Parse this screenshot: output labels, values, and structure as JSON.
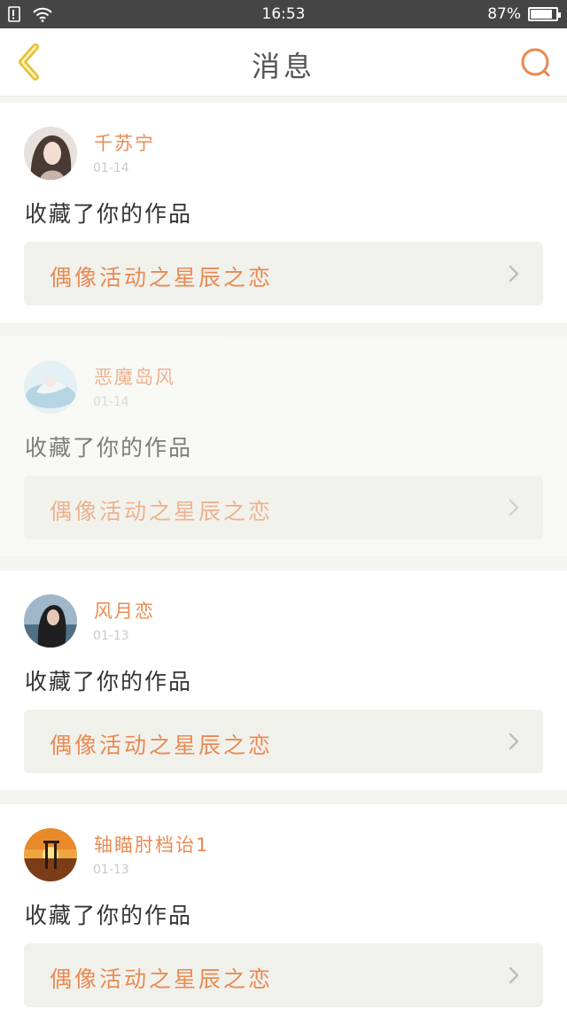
{
  "status_bar": {
    "time": "16:53",
    "battery": "87%",
    "battery_level": 0.87,
    "icons": [
      "sim-alert-icon",
      "wifi-icon",
      "battery-icon"
    ]
  },
  "header": {
    "title": "消息",
    "back_icon": "chevron-left-icon",
    "search_icon": "search-icon"
  },
  "colors": {
    "accent": "#e98a52",
    "back_icon": "#e8c13a",
    "status_bar": "#454545"
  },
  "messages": [
    {
      "username": "千苏宁",
      "date": "01-14",
      "action": "收藏了你的作品",
      "work_title": "偶像活动之星辰之恋"
    },
    {
      "username": "恶魔岛风",
      "date": "01-14",
      "action": "收藏了你的作品",
      "work_title": "偶像活动之星辰之恋"
    },
    {
      "username": "风月恋",
      "date": "01-13",
      "action": "收藏了你的作品",
      "work_title": "偶像活动之星辰之恋"
    },
    {
      "username": "轴瞄肘档诒1",
      "date": "01-13",
      "action": "收藏了你的作品",
      "work_title": "偶像活动之星辰之恋"
    }
  ]
}
